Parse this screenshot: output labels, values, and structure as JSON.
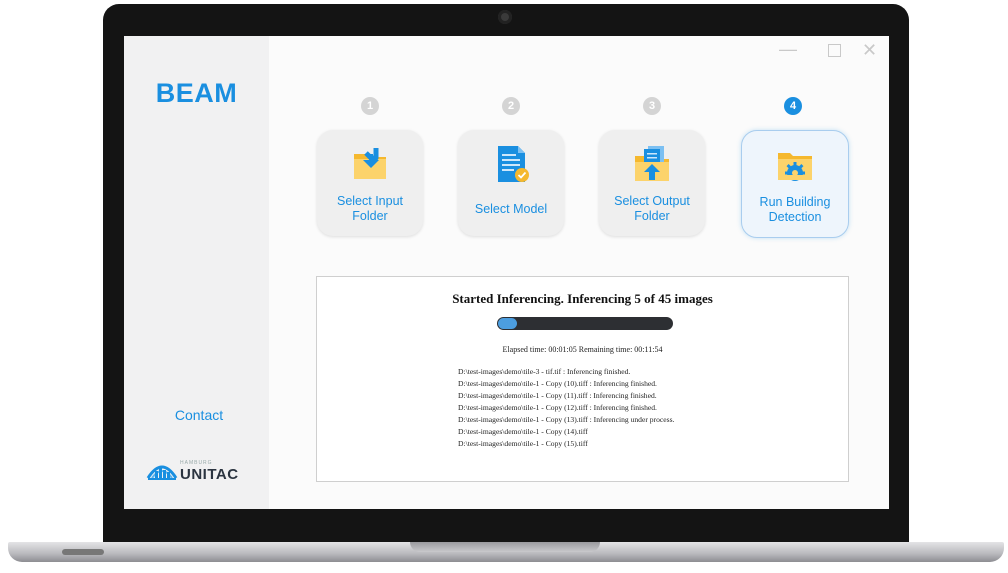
{
  "app": {
    "title": "BEAM",
    "contact_label": "Contact",
    "logo": {
      "small_text": "HAMBURG",
      "name": "UNITAC"
    },
    "accent_color": "#1a8fe0"
  },
  "window_controls": {
    "minimize": "—",
    "close": "✕"
  },
  "steps": [
    {
      "number": "1",
      "label_line1": "Select Input",
      "label_line2": "Folder",
      "icon": "folder-import-icon",
      "active": false
    },
    {
      "number": "2",
      "label_line1": "Select Model",
      "label_line2": "",
      "icon": "document-check-icon",
      "active": false
    },
    {
      "number": "3",
      "label_line1": "Select Output",
      "label_line2": "Folder",
      "icon": "folder-export-icon",
      "active": false
    },
    {
      "number": "4",
      "label_line1": "Run Building",
      "label_line2": "Detection",
      "icon": "folder-gear-icon",
      "active": true
    }
  ],
  "status": {
    "heading": "Started Inferencing. Inferencing 5 of 45 images",
    "progress_fraction": 0.111,
    "elapsed_text": "Elapsed time: 00:01:05 Remaining time: 00:11:54"
  },
  "log": [
    "D:\\test-images\\demo\\tile-3 - tif.tif : Inferencing finished.",
    "D:\\test-images\\demo\\tile-1 - Copy (10).tiff : Inferencing finished.",
    "D:\\test-images\\demo\\tile-1 - Copy (11).tiff : Inferencing finished.",
    "D:\\test-images\\demo\\tile-1 - Copy (12).tiff : Inferencing finished.",
    "D:\\test-images\\demo\\tile-1 - Copy (13).tiff : Inferencing under process.",
    "D:\\test-images\\demo\\tile-1 - Copy (14).tiff",
    "D:\\test-images\\demo\\tile-1 - Copy (15).tiff"
  ]
}
